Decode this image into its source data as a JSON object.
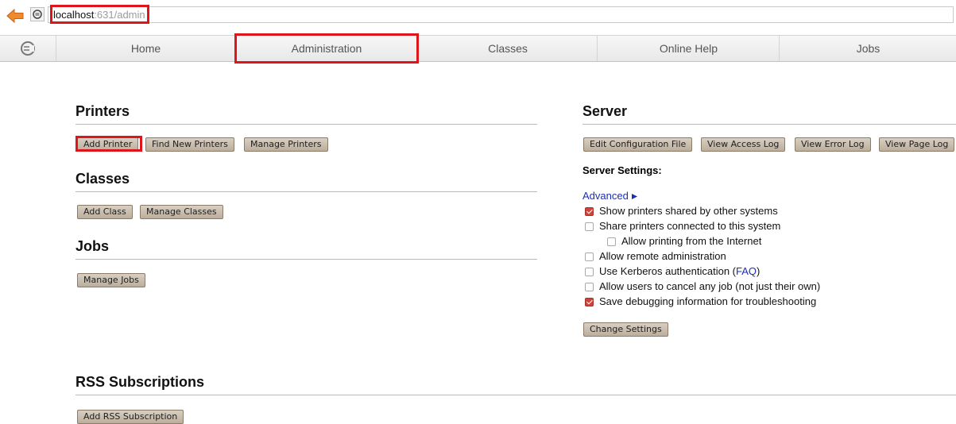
{
  "browser": {
    "url_host": "localhost",
    "url_rest": ":631/admin"
  },
  "nav": {
    "tabs": [
      "Home",
      "Administration",
      "Classes",
      "Online Help",
      "Jobs"
    ]
  },
  "printers": {
    "title": "Printers",
    "buttons": [
      "Add Printer",
      "Find New Printers",
      "Manage Printers"
    ]
  },
  "classes": {
    "title": "Classes",
    "buttons": [
      "Add Class",
      "Manage Classes"
    ]
  },
  "jobs": {
    "title": "Jobs",
    "buttons": [
      "Manage Jobs"
    ]
  },
  "server": {
    "title": "Server",
    "buttons": [
      "Edit Configuration File",
      "View Access Log",
      "View Error Log",
      "View Page Log"
    ],
    "settings_label": "Server Settings:",
    "advanced_label": "Advanced",
    "options": [
      {
        "label": "Show printers shared by other systems",
        "checked": true
      },
      {
        "label": "Share printers connected to this system",
        "checked": false
      },
      {
        "label": "Allow printing from the Internet",
        "checked": false
      },
      {
        "label": "Allow remote administration",
        "checked": false
      },
      {
        "label": "Use Kerberos authentication",
        "link": "FAQ",
        "checked": false
      },
      {
        "label": "Allow users to cancel any job (not just their own)",
        "checked": false
      },
      {
        "label": "Save debugging information for troubleshooting",
        "checked": true
      }
    ],
    "change_settings_label": "Change Settings"
  },
  "rss": {
    "title": "RSS Subscriptions",
    "buttons": [
      "Add RSS Subscription"
    ]
  },
  "colors": {
    "highlight": "#e0141b",
    "button_bg": "#c8bcad",
    "link": "#1c2fb0",
    "checked": "#d0423a"
  }
}
